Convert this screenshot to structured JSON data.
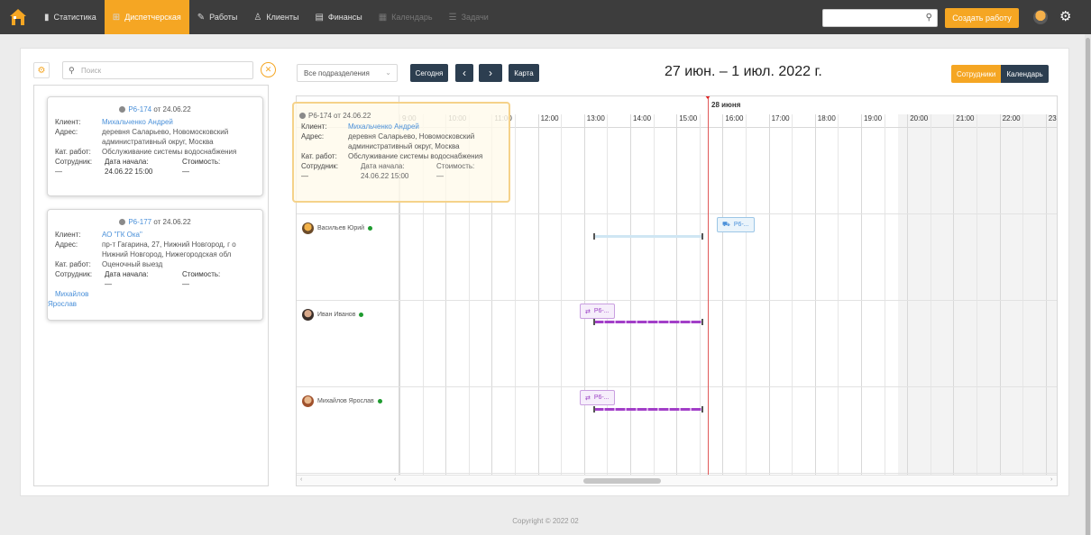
{
  "nav": {
    "items": [
      {
        "label": "Статистика",
        "icon": "bar-chart-icon"
      },
      {
        "label": "Диспетчерская",
        "icon": "dashboard-icon"
      },
      {
        "label": "Работы",
        "icon": "wrench-icon"
      },
      {
        "label": "Клиенты",
        "icon": "user-icon"
      },
      {
        "label": "Финансы",
        "icon": "money-icon"
      },
      {
        "label": "Календарь",
        "icon": "calendar-icon"
      },
      {
        "label": "Задачи",
        "icon": "tasks-icon"
      }
    ],
    "create_label": "Создать работу",
    "accent": "#f5a623",
    "dark": "#3d3d3d"
  },
  "left": {
    "search_placeholder": "Поиск",
    "cards": [
      {
        "number": "Р6-174",
        "date": "от 24.06.22",
        "client_label": "Клиент:",
        "client": "Михальченко Андрей",
        "address_label": "Адрес:",
        "address_1": "деревня Саларьево, Новомосковский",
        "address_2": "административный округ, Москва",
        "category_label": "Кат. работ:",
        "category": "Обслуживание системы водоснабжения",
        "employee_label": "Сотрудник:",
        "employee": "—",
        "start_label": "Дата начала:",
        "start": "24.06.22 15:00",
        "cost_label": "Стоимость:",
        "cost": "—"
      },
      {
        "number": "Р6-177",
        "date": "от 24.06.22",
        "client_label": "Клиент:",
        "client": "АО \"ГК Ока\"",
        "address_label": "Адрес:",
        "address_1": "пр-т Гагарина, 27, Нижний Новгород, г о",
        "address_2": "Нижний Новгород, Нижегородская обл",
        "category_label": "Кат. работ:",
        "category": "Оценочный выезд",
        "employee_label": "Сотрудник:",
        "employee_1": "Михайлов",
        "employee_2": "Ярослав",
        "start_label": "Дата начала:",
        "start": "—",
        "cost_label": "Стоимость:",
        "cost": "—"
      }
    ]
  },
  "toolbar": {
    "department": "Все подразделения",
    "today": "Сегодня",
    "prev": "‹",
    "next": "›",
    "map": "Карта",
    "week_title": "27 июн. – 1 июл. 2022 г.",
    "view_employees": "Сотрудники",
    "view_calendar": "Календарь"
  },
  "timeline": {
    "day_label": "28 июня",
    "hours": [
      "9:00",
      "10:00",
      "11:00",
      "12:00",
      "13:00",
      "14:00",
      "15:00",
      "16:00",
      "17:00",
      "18:00",
      "19:00",
      "20:00",
      "21:00",
      "22:00",
      "23:00"
    ],
    "employees": [
      {
        "name": "Васильев Юрий",
        "online": true
      },
      {
        "name": "Иван Иванов",
        "online": true
      },
      {
        "name": "Михайлов Ярослав",
        "online": true
      }
    ],
    "chips": [
      "Р6-...",
      "Р6-...",
      "Р6-..."
    ]
  },
  "ghost": {
    "number": "Р6-174",
    "date": "от 24.06.22",
    "client_label": "Клиент:",
    "client": "Михальченко Андрей",
    "address_label": "Адрес:",
    "address_1": "деревня Саларьево, Новомосковский",
    "address_2": "административный округ, Москва",
    "category_label": "Кат. работ:",
    "category": "Обслуживание системы водоснабжения",
    "employee_label": "Сотрудник:",
    "employee": "—",
    "start_label": "Дата начала:",
    "start": "24.06.22 15:00",
    "cost_label": "Стоимость:",
    "cost": "—"
  },
  "footer": {
    "copyright": "Copyright © 2022 02"
  }
}
